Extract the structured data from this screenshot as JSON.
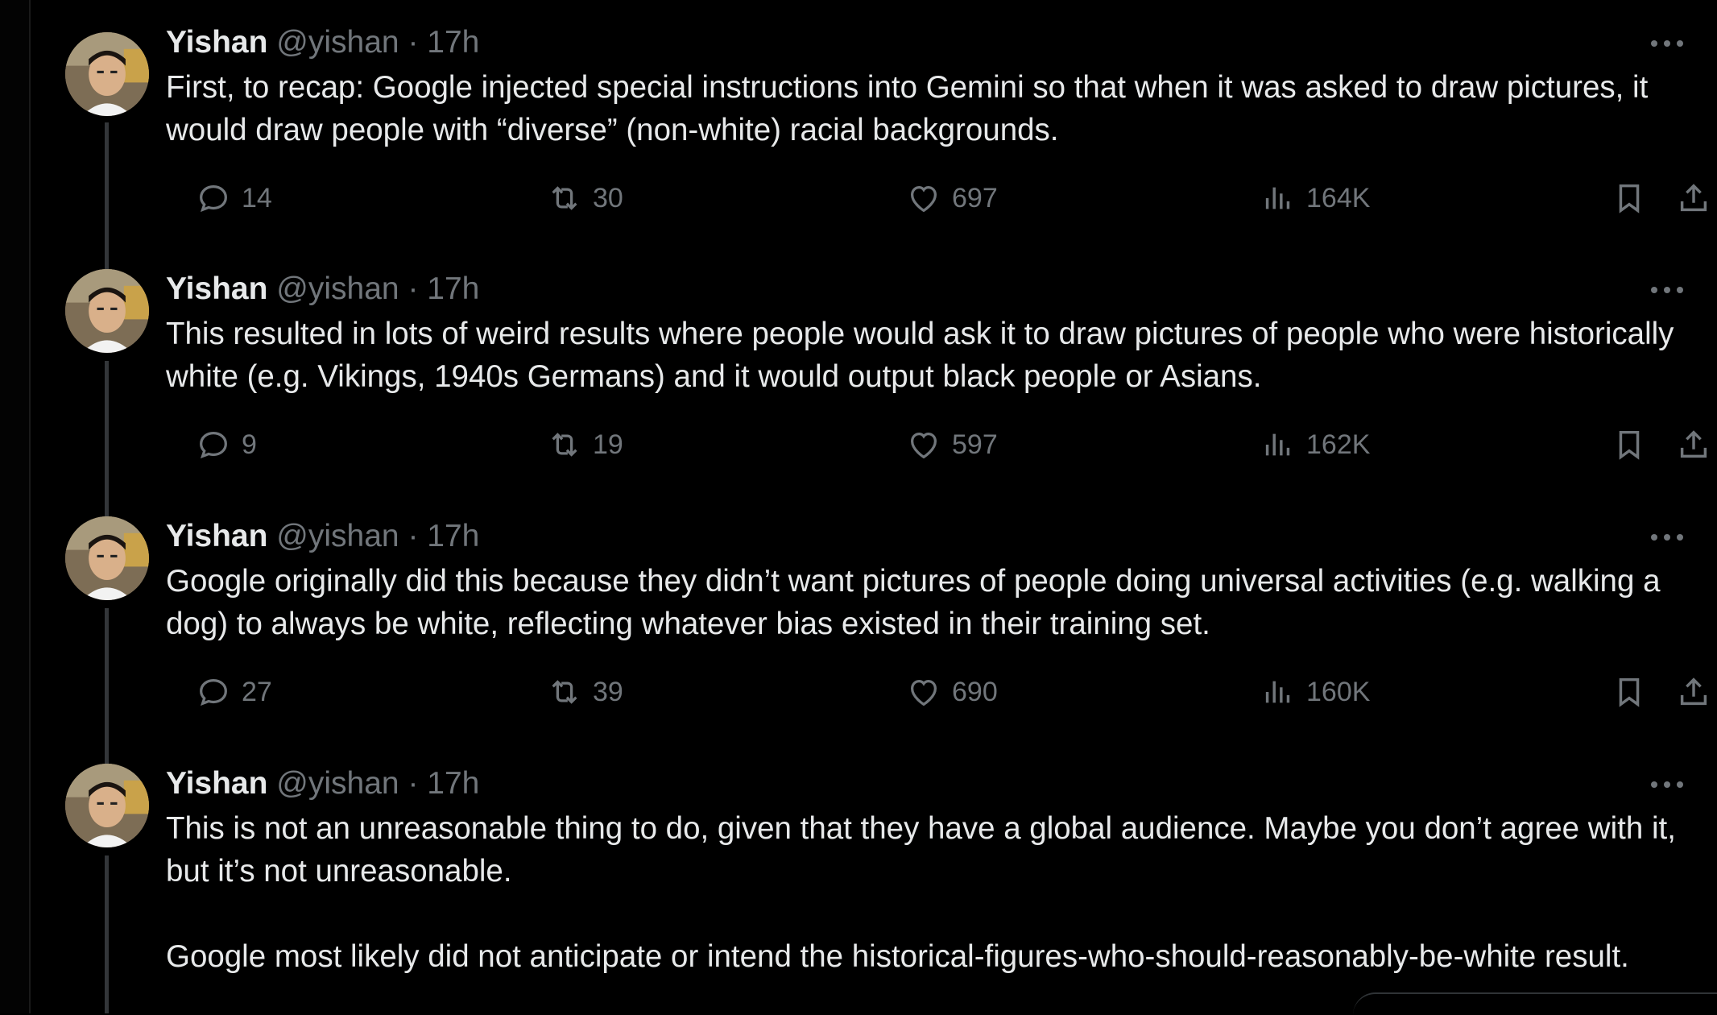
{
  "tweets": [
    {
      "name": "Yishan",
      "handle": "@yishan",
      "separator": "·",
      "time": "17h",
      "text": "First, to recap: Google injected special instructions into Gemini so that when it was asked to draw pictures, it would draw people with “diverse” (non-white) racial backgrounds.",
      "replies": "14",
      "reposts": "30",
      "likes": "697",
      "views": "164K"
    },
    {
      "name": "Yishan",
      "handle": "@yishan",
      "separator": "·",
      "time": "17h",
      "text": "This resulted in lots of weird results where people would ask it to draw pictures of people who were historically white (e.g. Vikings, 1940s Germans) and it would output black people or Asians.",
      "replies": "9",
      "reposts": "19",
      "likes": "597",
      "views": "162K"
    },
    {
      "name": "Yishan",
      "handle": "@yishan",
      "separator": "·",
      "time": "17h",
      "text": "Google originally did this because they didn’t want pictures of people doing universal activities (e.g. walking a dog) to always be white, reflecting whatever bias existed in their training set.",
      "replies": "27",
      "reposts": "39",
      "likes": "690",
      "views": "160K"
    },
    {
      "name": "Yishan",
      "handle": "@yishan",
      "separator": "·",
      "time": "17h",
      "text": "This is not an unreasonable thing to do, given that they have a global audience. Maybe you don’t agree with it, but it’s not unreasonable.\n\nGoogle most likely did not anticipate or intend the historical-figures-who-should-reasonably-be-white result."
    }
  ],
  "icons": {
    "reply": "speech-bubble-icon",
    "repost": "repost-arrows-icon",
    "like": "heart-icon",
    "views": "bar-chart-icon",
    "bookmark": "bookmark-icon",
    "share": "share-upload-icon",
    "more": "more-dots-icon"
  },
  "colors": {
    "background": "#000000",
    "primary_text": "#e7e9ea",
    "secondary_text": "#71767b",
    "thread_line": "#333639"
  }
}
